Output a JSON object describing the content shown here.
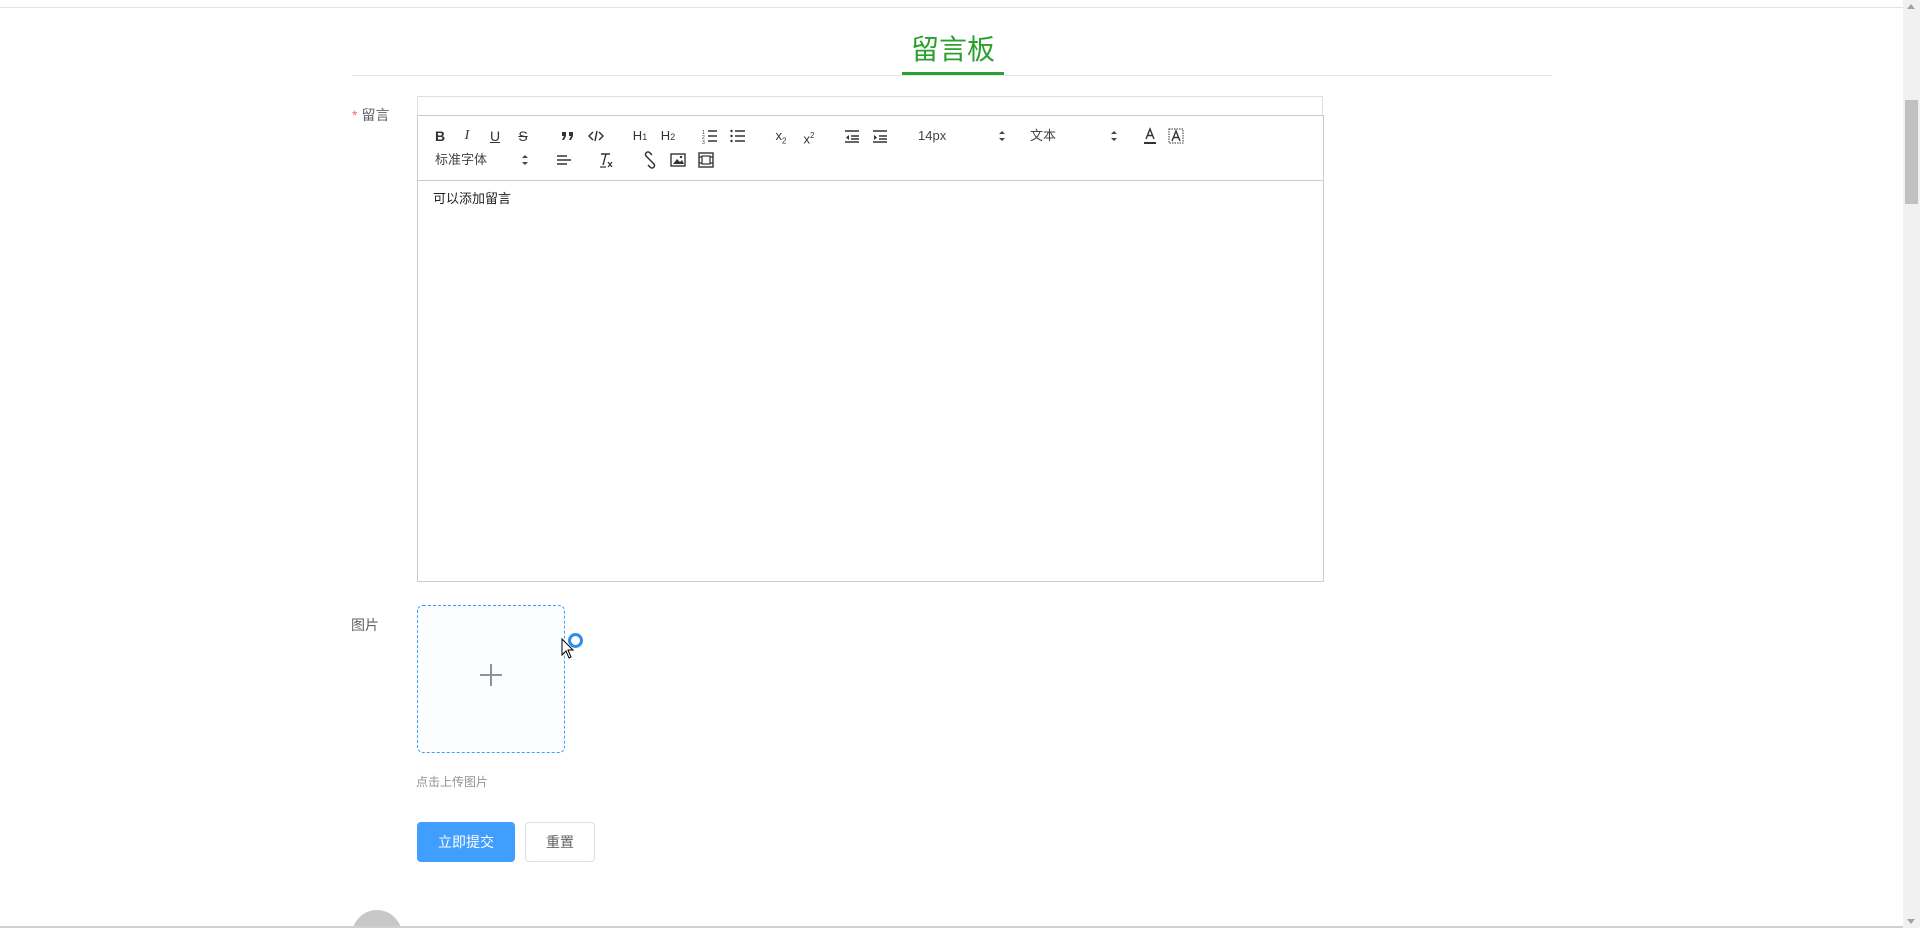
{
  "page": {
    "title": "留言板"
  },
  "form": {
    "message_label": "留言",
    "required_mark": "*",
    "image_label": "图片",
    "upload_tip": "点击上传图片",
    "submit_label": "立即提交",
    "reset_label": "重置"
  },
  "editor": {
    "content": "可以添加留言",
    "font_size_value": "14px",
    "header_value": "文本",
    "font_family_value": "标准字体",
    "toolbar_buttons": {
      "bold": "B",
      "italic": "I",
      "underline": "U",
      "strike": "S",
      "h1": "H1",
      "h2": "H2",
      "sub": "x2",
      "sup": "x2"
    }
  },
  "colors": {
    "accent_green": "#2ca02c",
    "primary_blue": "#409eff"
  }
}
